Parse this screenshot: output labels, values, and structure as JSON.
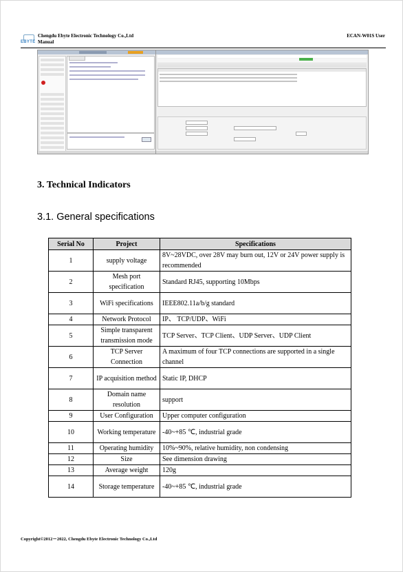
{
  "header": {
    "logo_text": "EBYTE",
    "company_line1": "Chengdu Ebyte Electronic Technology Co.,Ltd",
    "company_line2": "Manual",
    "doc_id": "ECAN-W01S User"
  },
  "section_heading": "3. Technical Indicators",
  "subsection_heading": "3.1.  General specifications",
  "table": {
    "headers": [
      "Serial No",
      "Project",
      "Specifications"
    ],
    "rows": [
      [
        "1",
        "supply voltage",
        "8V~28VDC, over 28V may burn out, 12V or 24V power supply is recommended"
      ],
      [
        "2",
        "Mesh port specification",
        "Standard RJ45, supporting 10Mbps"
      ],
      [
        "3",
        "WiFi specifications",
        "IEEE802.11a/b/g standard"
      ],
      [
        "4",
        "Network Protocol",
        "IP、 TCP/UDP、WiFi"
      ],
      [
        "5",
        "Simple transparent transmission mode",
        "TCP Server、TCP Client、UDP Server、UDP Client"
      ],
      [
        "6",
        "TCP Server Connection",
        "A maximum of four TCP connections are supported in a single channel"
      ],
      [
        "7",
        "IP acquisition method",
        "Static IP, DHCP"
      ],
      [
        "8",
        "Domain name resolution",
        "support"
      ],
      [
        "9",
        "User Configuration",
        "Upper computer configuration"
      ],
      [
        "10",
        "Working temperature",
        "-40~+85 ℃, industrial grade"
      ],
      [
        "11",
        "Operating humidity",
        "10%~90%, relative humidity, non condensing"
      ],
      [
        "12",
        "Size",
        "See dimension drawing"
      ],
      [
        "13",
        "Average weight",
        "120g"
      ],
      [
        "14",
        "Storage temperature",
        "-40~+85 ℃, industrial grade"
      ]
    ]
  },
  "footer": "Copyright©2012－2022, Chengdu Ebyte Electronic Technology Co.,Ltd"
}
